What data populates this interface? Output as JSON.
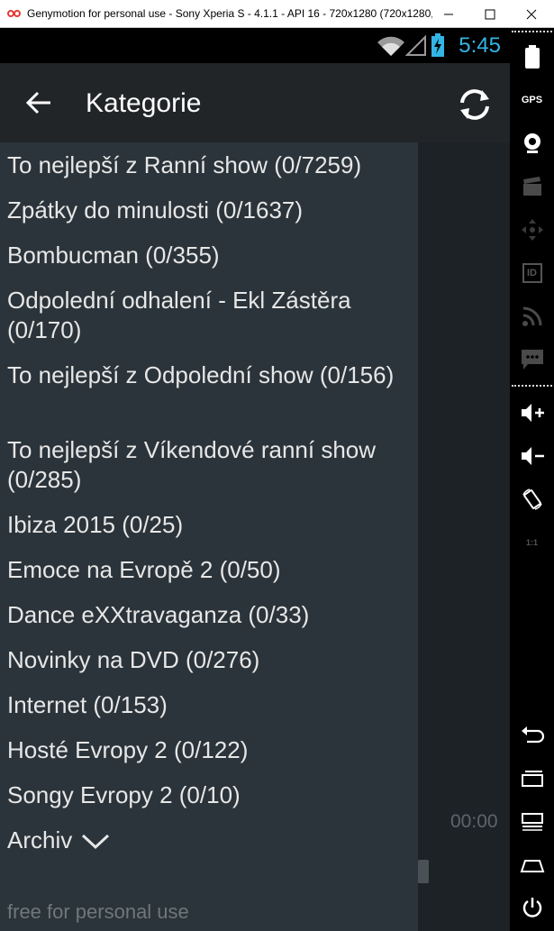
{
  "window": {
    "title": "Genymotion for personal use - Sony Xperia S - 4.1.1 - API 16 - 720x1280 (720x1280, ..."
  },
  "status_bar": {
    "time": "5:45",
    "accent_color": "#33b5e5"
  },
  "action_bar": {
    "title": "Kategorie",
    "back_icon": "arrow-back-icon",
    "refresh_icon": "refresh-icon"
  },
  "categories": [
    "To nejlepší z Ranní show (0/7259)",
    "Zpátky do minulosti (0/1637)",
    "Bombucman (0/355)",
    "Odpolední odhalení - Ekl Zástěra (0/170)",
    "To nejlepší z Odpolední show (0/156)",
    "To nejlepší z Víkendové ranní show (0/285)",
    "Ibiza 2015 (0/25)",
    "Emoce na Evropě 2 (0/50)",
    "Dance eXXtravaganza (0/33)",
    "Novinky na DVD (0/276)",
    "Internet (0/153)",
    "Hosté Evropy 2 (0/122)",
    "Songy Evropy 2 (0/10)"
  ],
  "archive": {
    "label": "Archiv"
  },
  "player": {
    "time": "00:00"
  },
  "watermark": "free for personal use",
  "toolbar": {
    "gps_label": "GPS",
    "id_label": "ID",
    "scale_label": "1:1"
  }
}
